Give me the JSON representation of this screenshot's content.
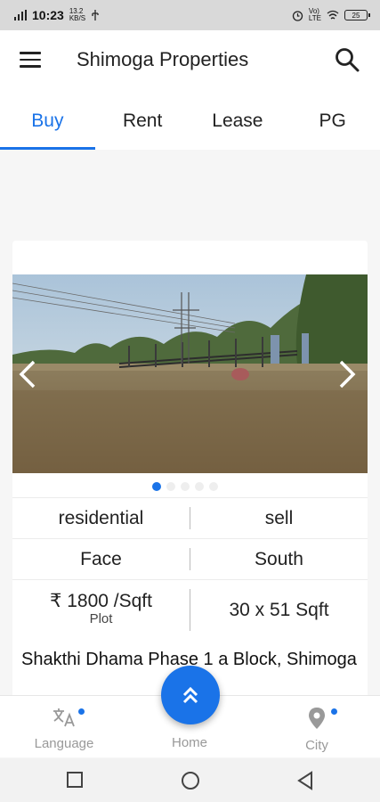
{
  "status_bar": {
    "time": "10:23",
    "left_small": "13.2\nKB/S",
    "right_small": "Vo) LTE",
    "battery": "25"
  },
  "app_bar": {
    "title": "Shimoga Properties",
    "menu_icon": "hamburger-menu-icon",
    "search_icon": "search-icon"
  },
  "tabs": [
    {
      "label": "Buy",
      "active": true
    },
    {
      "label": "Rent",
      "active": false
    },
    {
      "label": "Lease",
      "active": false
    },
    {
      "label": "PG",
      "active": false
    }
  ],
  "listing": {
    "image_alt": "plot-photo",
    "carousel": {
      "dot_count": 5,
      "active_index": 0
    },
    "category": "residential",
    "transaction": "sell",
    "facing_label": "Face",
    "facing_value": "South",
    "price": "₹ 1800  /Sqft",
    "price_type": "Plot",
    "size": "30 x 51  Sqft",
    "title": "Shakthi Dhama Phase 1 a Block, Shimoga"
  },
  "bottom_nav": {
    "language": "Language",
    "home": "Home",
    "city": "City"
  },
  "colors": {
    "accent": "#1a73e8",
    "status_bar": "#d9d9d9"
  }
}
